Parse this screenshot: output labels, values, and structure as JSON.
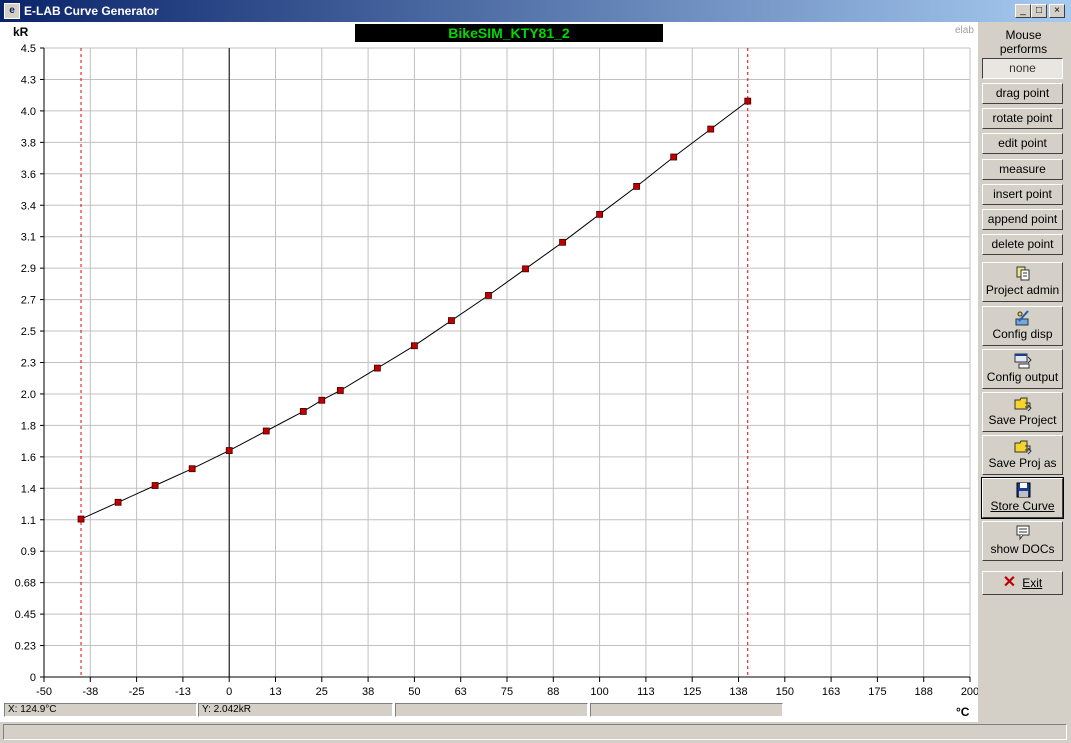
{
  "window": {
    "title": "E-LAB Curve Generator",
    "icon": "elab-app-icon",
    "controls": [
      "_",
      "□",
      "×"
    ]
  },
  "curve_name": "BikeSIM_KTY81_2",
  "watermark": "elab",
  "sidebar": {
    "heading": "Mouse performs",
    "mode_buttons": [
      "none",
      "drag point",
      "rotate point",
      "edit point",
      "measure",
      "insert point",
      "append point",
      "delete point"
    ],
    "selected_mode": "none",
    "action_buttons": [
      {
        "label": "Project admin",
        "icon": "project-admin-icon"
      },
      {
        "label": "Config disp",
        "icon": "config-display-icon"
      },
      {
        "label": "Config output",
        "icon": "config-output-icon"
      },
      {
        "label": "Save Project",
        "icon": "save-project-icon"
      },
      {
        "label": "Save Proj as",
        "icon": "save-project-as-icon"
      },
      {
        "label": "Store Curve",
        "icon": "floppy-disk-icon"
      },
      {
        "label": "show DOCs",
        "icon": "documents-icon"
      }
    ],
    "exit_label": "Exit",
    "exit_icon": "red-x-icon"
  },
  "status": {
    "x_readout": "X: 124.9°C",
    "y_readout": "Y: 2.042kR",
    "field3": "",
    "field4": ""
  },
  "chart_data": {
    "type": "line",
    "title": "BikeSIM_KTY81_2",
    "ylabel": "kR",
    "xlabel": "°C",
    "xlim": [
      -50,
      200
    ],
    "ylim": [
      0,
      4.5
    ],
    "x_tick_labels": [
      "-50",
      "-38",
      "-25",
      "-13",
      "0",
      "13",
      "25",
      "38",
      "50",
      "63",
      "75",
      "88",
      "100",
      "113",
      "125",
      "138",
      "150",
      "163",
      "175",
      "188",
      "200"
    ],
    "y_tick_labels": [
      "0",
      "0.23",
      "0.45",
      "0.68",
      "0.9",
      "1.1",
      "1.4",
      "1.6",
      "1.8",
      "2.0",
      "2.3",
      "2.5",
      "2.7",
      "2.9",
      "3.1",
      "3.4",
      "3.6",
      "3.8",
      "4.0",
      "4.3",
      "4.5"
    ],
    "grid": true,
    "limit_lines_x": [
      -40,
      140
    ],
    "series": [
      {
        "x": [
          -40,
          -30,
          -20,
          -10,
          0,
          10,
          20,
          25,
          30,
          40,
          50,
          60,
          70,
          80,
          90,
          100,
          110,
          120,
          130,
          140
        ],
        "values": [
          1.13,
          1.25,
          1.37,
          1.49,
          1.62,
          1.76,
          1.9,
          1.98,
          2.05,
          2.21,
          2.37,
          2.55,
          2.73,
          2.92,
          3.11,
          3.31,
          3.51,
          3.72,
          3.92,
          4.12
        ]
      }
    ]
  }
}
